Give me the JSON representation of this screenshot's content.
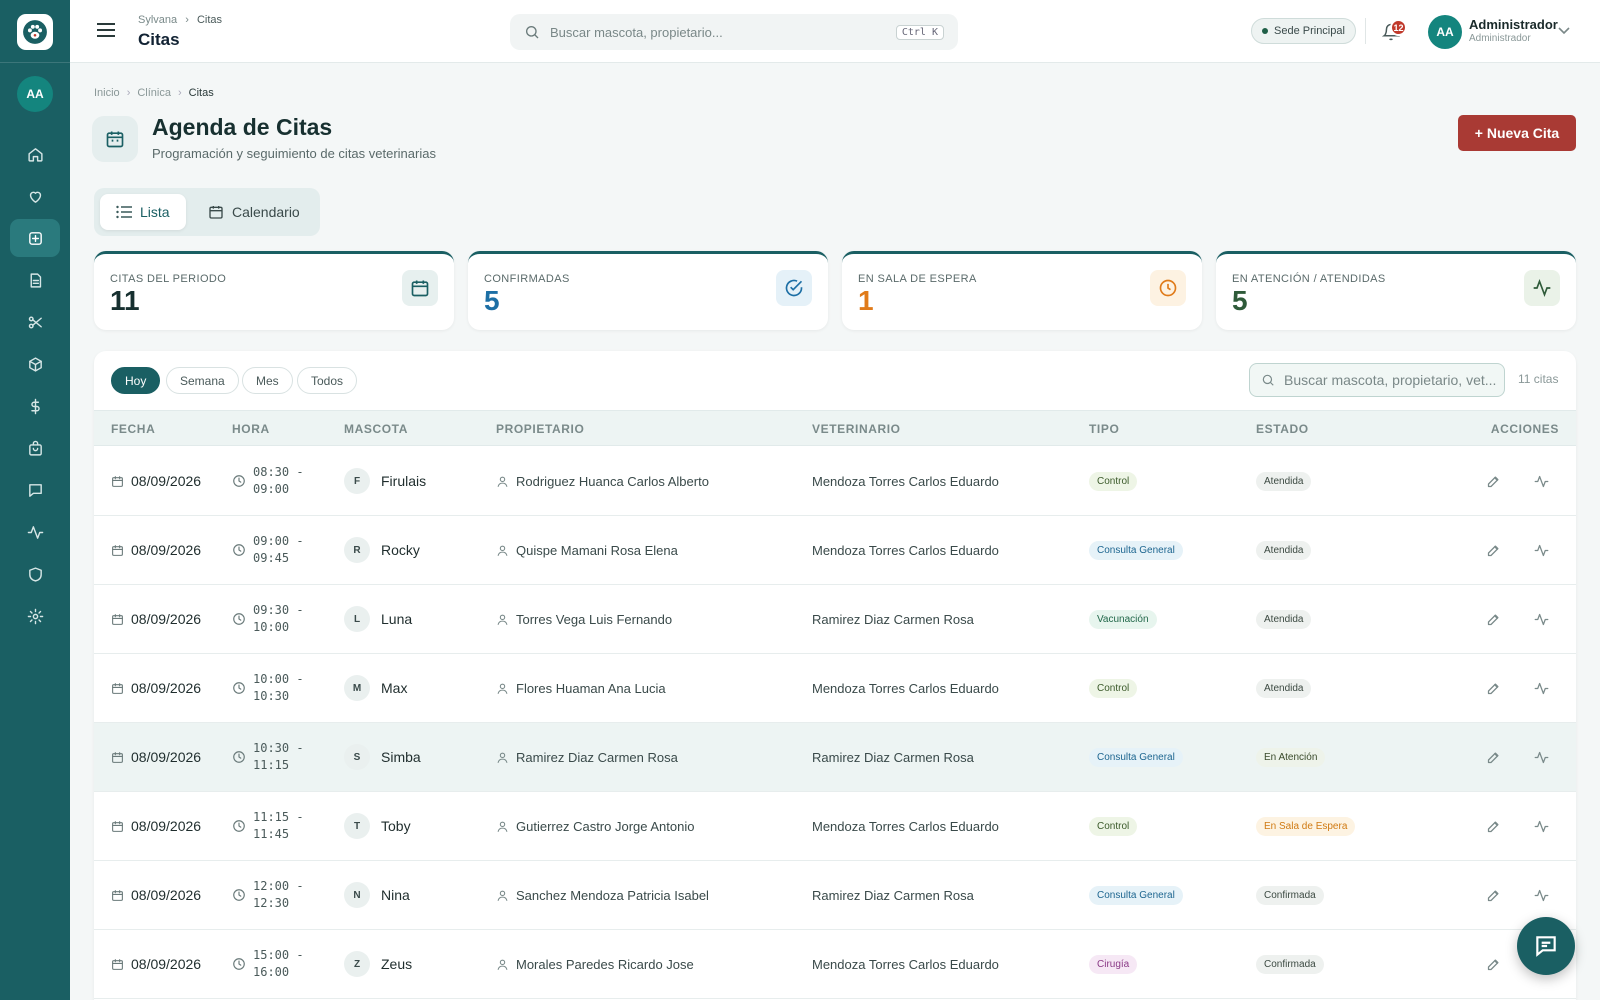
{
  "app": {
    "brand": "Sylvana",
    "section": "Citas",
    "title": "Citas"
  },
  "user": {
    "initials": "AA",
    "name": "Administrador",
    "role": "Administrador"
  },
  "search": {
    "placeholder": "Buscar mascota, propietario...",
    "shortcut": "Ctrl K"
  },
  "sede": "Sede Principal",
  "notifications": {
    "count": "12"
  },
  "sidebar": {
    "items": [
      {
        "icon": "home-icon"
      },
      {
        "icon": "heart-icon"
      },
      {
        "icon": "plus-square-icon",
        "active": true
      },
      {
        "icon": "document-icon"
      },
      {
        "icon": "scissors-icon"
      },
      {
        "icon": "box-icon"
      },
      {
        "icon": "dollar-icon"
      },
      {
        "icon": "bag-icon"
      },
      {
        "icon": "chat-icon"
      },
      {
        "icon": "activity-icon"
      },
      {
        "icon": "shield-icon"
      },
      {
        "icon": "gear-icon"
      }
    ]
  },
  "breadcrumb": [
    "Inicio",
    "Clínica",
    "Citas"
  ],
  "page": {
    "title": "Agenda de Citas",
    "subtitle": "Programación y seguimiento de citas veterinarias",
    "new_button": "+ Nueva Cita"
  },
  "view_toggle": {
    "list": "Lista",
    "calendar": "Calendario"
  },
  "stats": [
    {
      "label": "CITAS DEL PERIODO",
      "value": "11",
      "color": "#173030"
    },
    {
      "label": "CONFIRMADAS",
      "value": "5",
      "color": "#1d6fa5"
    },
    {
      "label": "EN SALA DE ESPERA",
      "value": "1",
      "color": "#e07b1a"
    },
    {
      "label": "EN ATENCIÓN / ATENDIDAS",
      "value": "5",
      "color": "#2f5b3a"
    }
  ],
  "filters": [
    "Hoy",
    "Semana",
    "Mes",
    "Todos"
  ],
  "table_search": {
    "placeholder": "Buscar mascota, propietario, vet..."
  },
  "count_label": "11 citas",
  "columns": [
    "FECHA",
    "HORA",
    "MASCOTA",
    "PROPIETARIO",
    "VETERINARIO",
    "TIPO",
    "ESTADO",
    "ACCIONES"
  ],
  "rows": [
    {
      "date": "08/09/2026",
      "start": "08:30 -",
      "end": "09:00",
      "initial": "F",
      "pet": "Firulais",
      "owner": "Rodriguez Huanca Carlos Alberto",
      "vet": "Mendoza Torres Carlos Eduardo",
      "type": "Control",
      "state": "Atendida"
    },
    {
      "date": "08/09/2026",
      "start": "09:00 -",
      "end": "09:45",
      "initial": "R",
      "pet": "Rocky",
      "owner": "Quispe Mamani Rosa Elena",
      "vet": "Mendoza Torres Carlos Eduardo",
      "type": "Consulta General",
      "state": "Atendida"
    },
    {
      "date": "08/09/2026",
      "start": "09:30 -",
      "end": "10:00",
      "initial": "L",
      "pet": "Luna",
      "owner": "Torres Vega Luis Fernando",
      "vet": "Ramirez Diaz Carmen Rosa",
      "type": "Vacunación",
      "state": "Atendida"
    },
    {
      "date": "08/09/2026",
      "start": "10:00 -",
      "end": "10:30",
      "initial": "M",
      "pet": "Max",
      "owner": "Flores Huaman Ana Lucia",
      "vet": "Mendoza Torres Carlos Eduardo",
      "type": "Control",
      "state": "Atendida"
    },
    {
      "date": "08/09/2026",
      "start": "10:30 -",
      "end": "11:15",
      "initial": "S",
      "pet": "Simba",
      "owner": "Ramirez Diaz Carmen Rosa",
      "vet": "Ramirez Diaz Carmen Rosa",
      "type": "Consulta General",
      "state": "En Atención",
      "highlight": true
    },
    {
      "date": "08/09/2026",
      "start": "11:15 -",
      "end": "11:45",
      "initial": "T",
      "pet": "Toby",
      "owner": "Gutierrez Castro Jorge Antonio",
      "vet": "Mendoza Torres Carlos Eduardo",
      "type": "Control",
      "state": "En Sala de Espera"
    },
    {
      "date": "08/09/2026",
      "start": "12:00 -",
      "end": "12:30",
      "initial": "N",
      "pet": "Nina",
      "owner": "Sanchez Mendoza Patricia Isabel",
      "vet": "Ramirez Diaz Carmen Rosa",
      "type": "Consulta General",
      "state": "Confirmada"
    },
    {
      "date": "08/09/2026",
      "start": "15:00 -",
      "end": "16:00",
      "initial": "Z",
      "pet": "Zeus",
      "owner": "Morales Paredes Ricardo Jose",
      "vet": "Mendoza Torres Carlos Eduardo",
      "type": "Cirugía",
      "state": "Confirmada"
    }
  ],
  "badge_colors": {
    "Control": {
      "bg": "#eef5e6",
      "fg": "#3b5a2a"
    },
    "Consulta General": {
      "bg": "#e6f2f8",
      "fg": "#1e6690"
    },
    "Vacunación": {
      "bg": "#e7f5ee",
      "fg": "#22684a"
    },
    "Cirugía": {
      "bg": "#f6e8f5",
      "fg": "#8a3a86"
    },
    "Atendida": {
      "bg": "#eef1ef",
      "fg": "#3c4a42"
    },
    "En Atención": {
      "bg": "#eef3ea",
      "fg": "#3a4a2a"
    },
    "En Sala de Espera": {
      "bg": "#fdf3e2",
      "fg": "#d07a12"
    },
    "Confirmada": {
      "bg": "#eef1ef",
      "fg": "#3c4a42"
    }
  }
}
